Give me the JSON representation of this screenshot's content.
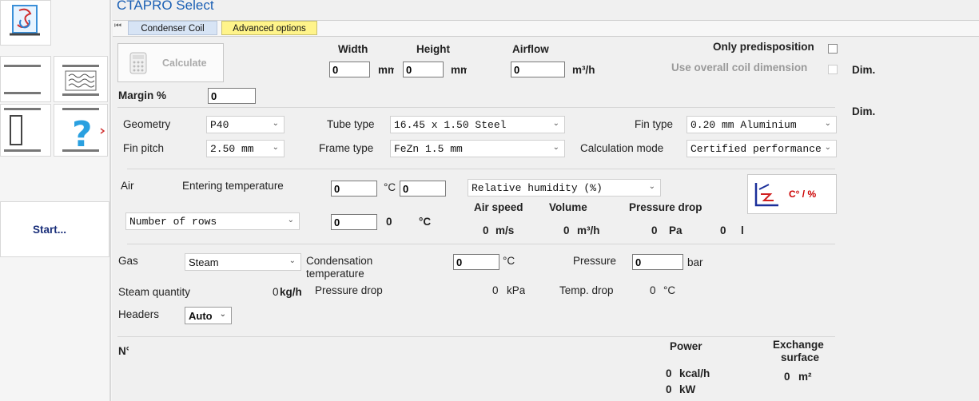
{
  "app": {
    "title": "CTAPRO Select",
    "start_label": "Start..."
  },
  "tabs": [
    {
      "label": "Condenser Coil",
      "active": true
    },
    {
      "label": "Advanced options",
      "active": false
    }
  ],
  "colors": {
    "title_blue": "#1a5fb4",
    "tab_active": "#d7e4f5",
    "tab_yellow": "#fff48a",
    "accent_red": "#cc0000"
  },
  "calculate": {
    "label": "Calculate"
  },
  "dimensions": {
    "width_label": "Width",
    "height_label": "Height",
    "airflow_label": "Airflow",
    "width_value": "0",
    "height_value": "0",
    "airflow_value": "0",
    "mm1": "mm",
    "mm2": "mm",
    "airflow_unit": "m³/h",
    "only_predisposition": "Only predisposition",
    "use_overall": "Use overall coil dimension",
    "dim1": "Dim.",
    "dim2": "Dim."
  },
  "margin": {
    "label": "Margin %",
    "value": "0"
  },
  "geometry": {
    "geometry_label": "Geometry",
    "geometry_value": "P40",
    "fin_pitch_label": "Fin pitch",
    "fin_pitch_value": "2.50 mm",
    "tube_type_label": "Tube type",
    "tube_type_value": "16.45 x 1.50 Steel",
    "frame_type_label": "Frame type",
    "frame_type_value": "FeZn 1.5 mm",
    "fin_type_label": "Fin type",
    "fin_type_value": "0.20 mm Aluminium",
    "calc_mode_label": "Calculation mode",
    "calc_mode_value": "Certified performance"
  },
  "air": {
    "air_label": "Air",
    "entering_label": "Entering temperature",
    "entering_value": "0",
    "deg_c": "°C",
    "humidity_value": "0",
    "humidity_select": "Relative humidity (%)",
    "rows_select": "Number of rows",
    "rows_input": "0",
    "rows_out": "0",
    "rows_unit": "°C",
    "air_speed_label": "Air speed",
    "volume_label": "Volume",
    "pressure_drop_label": "Pressure drop",
    "air_speed_value": "0",
    "air_speed_unit": "m/s",
    "volume_value": "0",
    "volume_unit": "m³/h",
    "pd_value": "0",
    "pd_unit": "Pa",
    "pd_value2": "0",
    "pd_unit2": "l",
    "unit_toggle": "C° / %"
  },
  "gas": {
    "gas_label": "Gas",
    "gas_value": "Steam",
    "cond_label_1": "Condensation",
    "cond_label_2": "temperature",
    "cond_value": "0",
    "cond_unit": "°C",
    "pressure_label": "Pressure",
    "pressure_value": "0",
    "pressure_unit": "bar",
    "steam_qty_label": "Steam quantity",
    "steam_qty_value": "0",
    "steam_qty_unit": "kg/h",
    "pd_label": "Pressure drop",
    "pd_value": "0",
    "pd_unit": "kPa",
    "temp_drop_label": "Temp. drop",
    "temp_drop_value": "0",
    "temp_drop_unit": "°C",
    "headers_label": "Headers",
    "headers_value": "Auto"
  },
  "results": {
    "n_label": "N°",
    "power_label": "Power",
    "exchange_label_1": "Exchange",
    "exchange_label_2": "surface",
    "power_kcal_value": "0",
    "power_kcal_unit": "kcal/h",
    "power_kw_value": "0",
    "power_kw_unit": "kW",
    "surface_value": "0",
    "surface_unit": "m²"
  }
}
